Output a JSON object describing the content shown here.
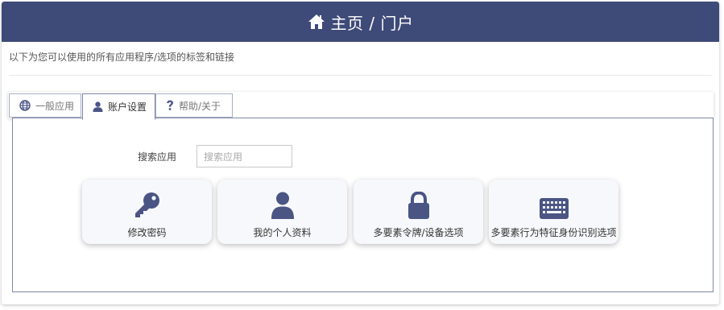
{
  "header": {
    "title": "主页 / 门户",
    "icon": "home-icon"
  },
  "description": "以下为您可以使用的所有应用程序/选项的标签和链接",
  "tabs": [
    {
      "label": "一般应用",
      "icon": "globe-icon",
      "active": false
    },
    {
      "label": "账户设置",
      "icon": "user-icon",
      "active": true
    },
    {
      "label": "帮助/关于",
      "icon": "question-icon",
      "active": false
    }
  ],
  "search": {
    "label": "搜索应用",
    "placeholder": "搜索应用"
  },
  "cards": [
    {
      "label": "修改密码",
      "icon": "key-icon"
    },
    {
      "label": "我的个人资料",
      "icon": "user-icon"
    },
    {
      "label": "多要素令牌/设备选项",
      "icon": "lock-icon"
    },
    {
      "label": "多要素行为特征身份识别选项",
      "icon": "keyboard-icon"
    }
  ],
  "colors": {
    "header_bg": "#3e4a78",
    "icon": "#4a5584",
    "tab_border": "#a8b0c8"
  }
}
